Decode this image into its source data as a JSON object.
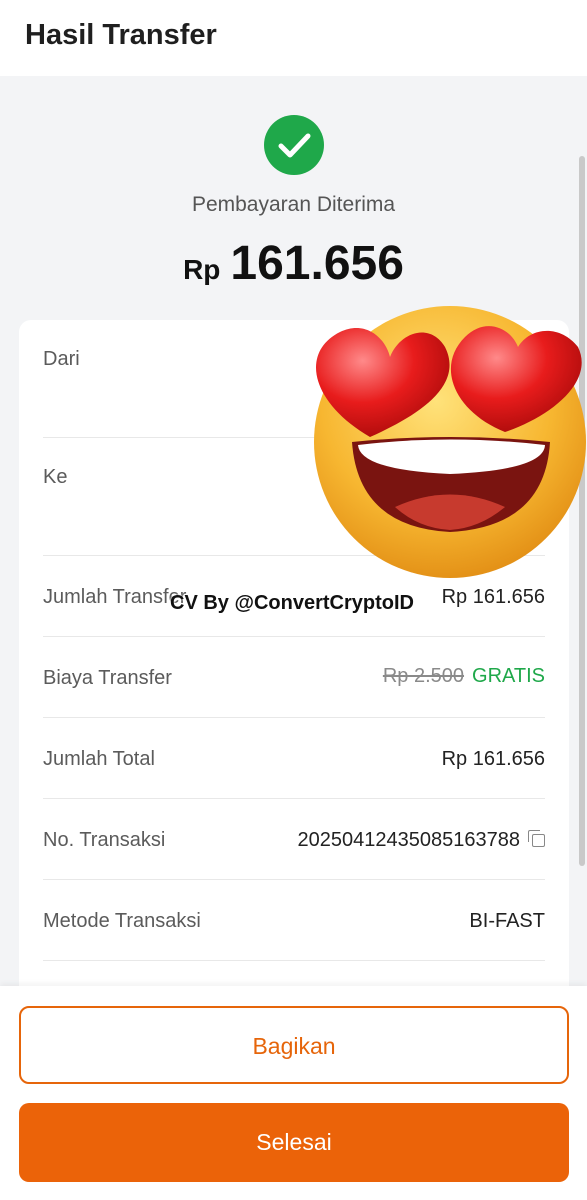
{
  "header": {
    "title": "Hasil Transfer"
  },
  "status": {
    "text": "Pembayaran Diterima",
    "icon": "check-circle-icon",
    "color": "#1fa84a"
  },
  "amount": {
    "currency": "Rp",
    "value": "161.656"
  },
  "details": {
    "from_label": "Dari",
    "to_label": "Ke",
    "transfer_amount_label": "Jumlah Transfer",
    "transfer_amount_value": "Rp 161.656",
    "fee_label": "Biaya Transfer",
    "fee_original": "Rp 2.500",
    "fee_value": "GRATIS",
    "total_label": "Jumlah Total",
    "total_value": "Rp 161.656",
    "transaction_no_label": "No. Transaksi",
    "transaction_no_value": "20250412435085163788",
    "method_label": "Metode Transaksi",
    "method_value": "BI-FAST"
  },
  "overlay": {
    "emoji": "heart-eyes-emoji",
    "watermark": "CV By @ConvertCryptoID"
  },
  "actions": {
    "share_label": "Bagikan",
    "done_label": "Selesai"
  },
  "colors": {
    "accent": "#eb6309",
    "success": "#1fa84a"
  }
}
